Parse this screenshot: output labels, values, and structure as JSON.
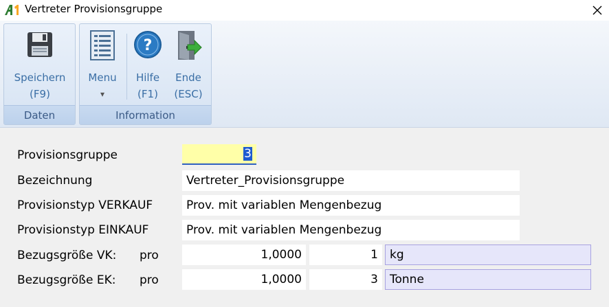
{
  "window": {
    "title": "Vertreter Provisionsgruppe",
    "logo_text": "A1",
    "close_glyph": "✕"
  },
  "ribbon": {
    "groups": [
      {
        "label": "Daten",
        "buttons": [
          {
            "line1": "Speichern",
            "line2": "(F9)",
            "icon": "floppy-disk-icon"
          }
        ]
      },
      {
        "label": "Information",
        "buttons": [
          {
            "line1": "Menu",
            "line2": "▾",
            "icon": "menu-list-icon"
          },
          {
            "line1": "Hilfe",
            "line2": "(F1)",
            "icon": "help-icon"
          },
          {
            "line1": "Ende",
            "line2": "(ESC)",
            "icon": "exit-door-icon"
          }
        ]
      }
    ]
  },
  "form": {
    "provisionsgruppe": {
      "label": "Provisionsgruppe",
      "value": "3"
    },
    "bezeichnung": {
      "label": "Bezeichnung",
      "value": "Vertreter_Provisionsgruppe"
    },
    "provisionstyp_vk": {
      "label": "Provisionstyp VERKAUF",
      "value": "Prov. mit variablen Mengenbezug"
    },
    "provisionstyp_ek": {
      "label": "Provisionstyp EINKAUF",
      "value": "Prov. mit variablen Mengenbezug"
    },
    "bezug_vk": {
      "label": "Bezugsgröße VK:",
      "pro": "pro",
      "amount": "1,0000",
      "qty": "1",
      "unit": "kg"
    },
    "bezug_ek": {
      "label": "Bezugsgröße EK:",
      "pro": "pro",
      "amount": "1,0000",
      "qty": "3",
      "unit": "Tonne"
    }
  },
  "colors": {
    "ribbon_text": "#3a6ea5",
    "group_label": "#3a5a86",
    "key_field_bg": "#ffffa8",
    "lookup_field_bg": "#e6e6fa",
    "selection": "#1e5bd0"
  }
}
